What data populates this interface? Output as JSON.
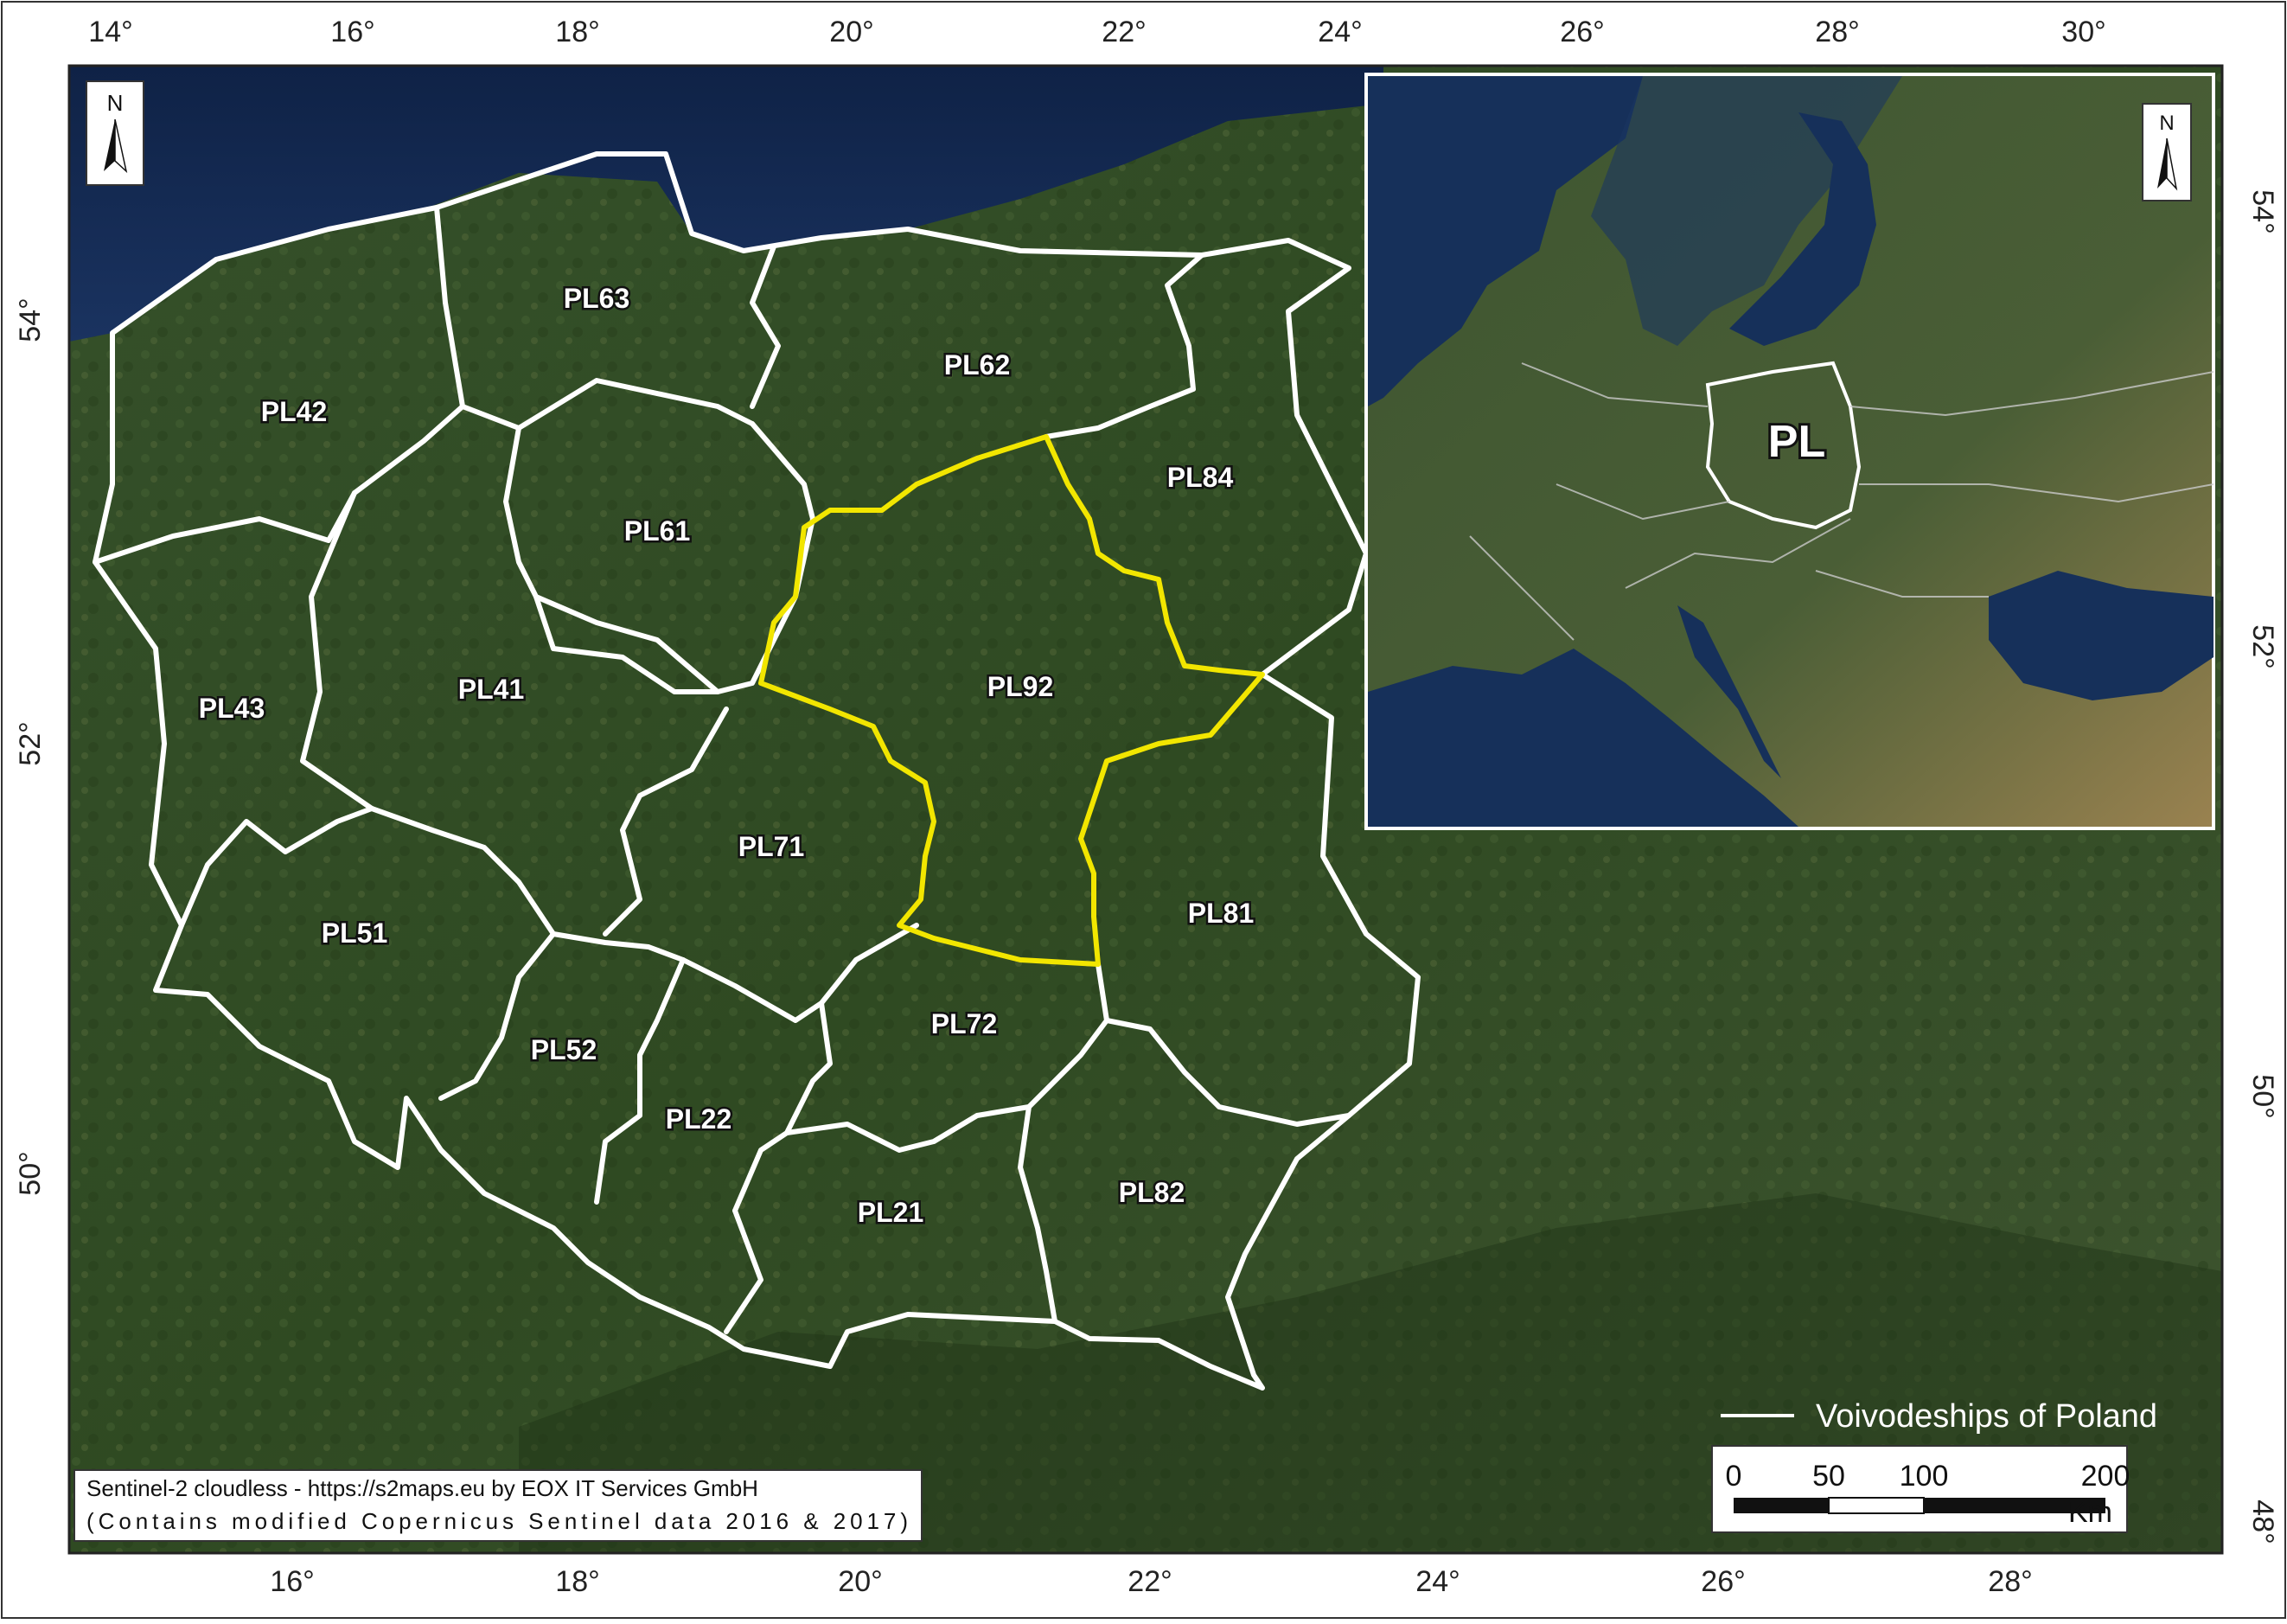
{
  "map": {
    "legend_label": "Voivodeships of Poland",
    "inset_label": "PL",
    "north_label": "N",
    "credit_line1": "Sentinel-2 cloudless - https://s2maps.eu by EOX IT Services GmbH",
    "credit_line2": "(Contains modified Copernicus Sentinel data 2016 & 2017)",
    "scale": {
      "ticks": [
        "0",
        "50",
        "100",
        "200"
      ],
      "unit": "Km"
    },
    "highlight_region": "PL92",
    "regions": [
      {
        "code": "PL42"
      },
      {
        "code": "PL63"
      },
      {
        "code": "PL62"
      },
      {
        "code": "PL84"
      },
      {
        "code": "PL61"
      },
      {
        "code": "PL41"
      },
      {
        "code": "PL43"
      },
      {
        "code": "PL92"
      },
      {
        "code": "PL71"
      },
      {
        "code": "PL81"
      },
      {
        "code": "PL51"
      },
      {
        "code": "PL52"
      },
      {
        "code": "PL22"
      },
      {
        "code": "PL72"
      },
      {
        "code": "PL21"
      },
      {
        "code": "PL82"
      }
    ],
    "main_ticks": {
      "top": [
        "14°",
        "16°",
        "18°",
        "20°",
        "22°",
        "24°"
      ],
      "bottom": [
        "16°",
        "18°",
        "20°",
        "22°",
        "24°",
        "26°",
        "28°"
      ],
      "left": [
        "54°",
        "52°",
        "50°"
      ],
      "right": [
        "50°",
        "48°"
      ]
    },
    "inset_ticks": {
      "top": [
        "26°",
        "28°",
        "30°"
      ],
      "right": [
        "54°",
        "52°"
      ]
    },
    "colors": {
      "boundary": "#ffffff",
      "highlight": "#f2e600",
      "sea": "#12254a",
      "land": "#2f4a22"
    }
  }
}
